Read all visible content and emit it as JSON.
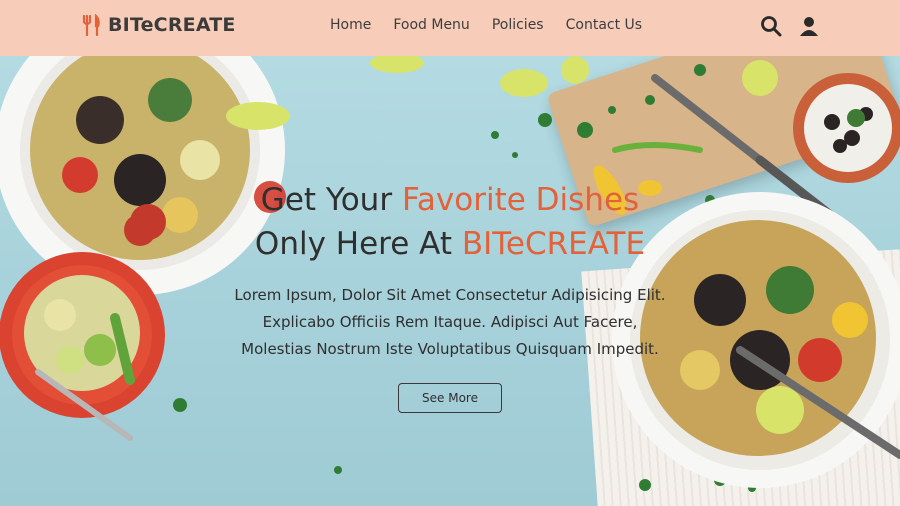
{
  "brand": {
    "name": "BITeCREATE",
    "logo_icon": "fork-knife-icon"
  },
  "nav": {
    "items": [
      "Home",
      "Food Menu",
      "Policies",
      "Contact Us"
    ],
    "search_icon": "search-icon",
    "user_icon": "user-icon"
  },
  "hero": {
    "line1_plain": "Get Your ",
    "line1_accent": "Favorite Dishes",
    "line2_plain": "Only Here At ",
    "line2_accent": "BITeCREATE",
    "paragraph_lines": [
      "Lorem Ipsum, Dolor Sit Amet Consectetur Adipisicing Elit.",
      "Explicabo Officiis Rem Itaque. Adipisci Aut Facere,",
      "Molestias Nostrum Iste Voluptatibus Quisquam Impedit."
    ],
    "button_label": "See More"
  },
  "colors": {
    "nav_bg": "#f7cdb9",
    "accent": "#e3623a",
    "text": "#2f2f2f",
    "bg": "#a9d3dc"
  }
}
